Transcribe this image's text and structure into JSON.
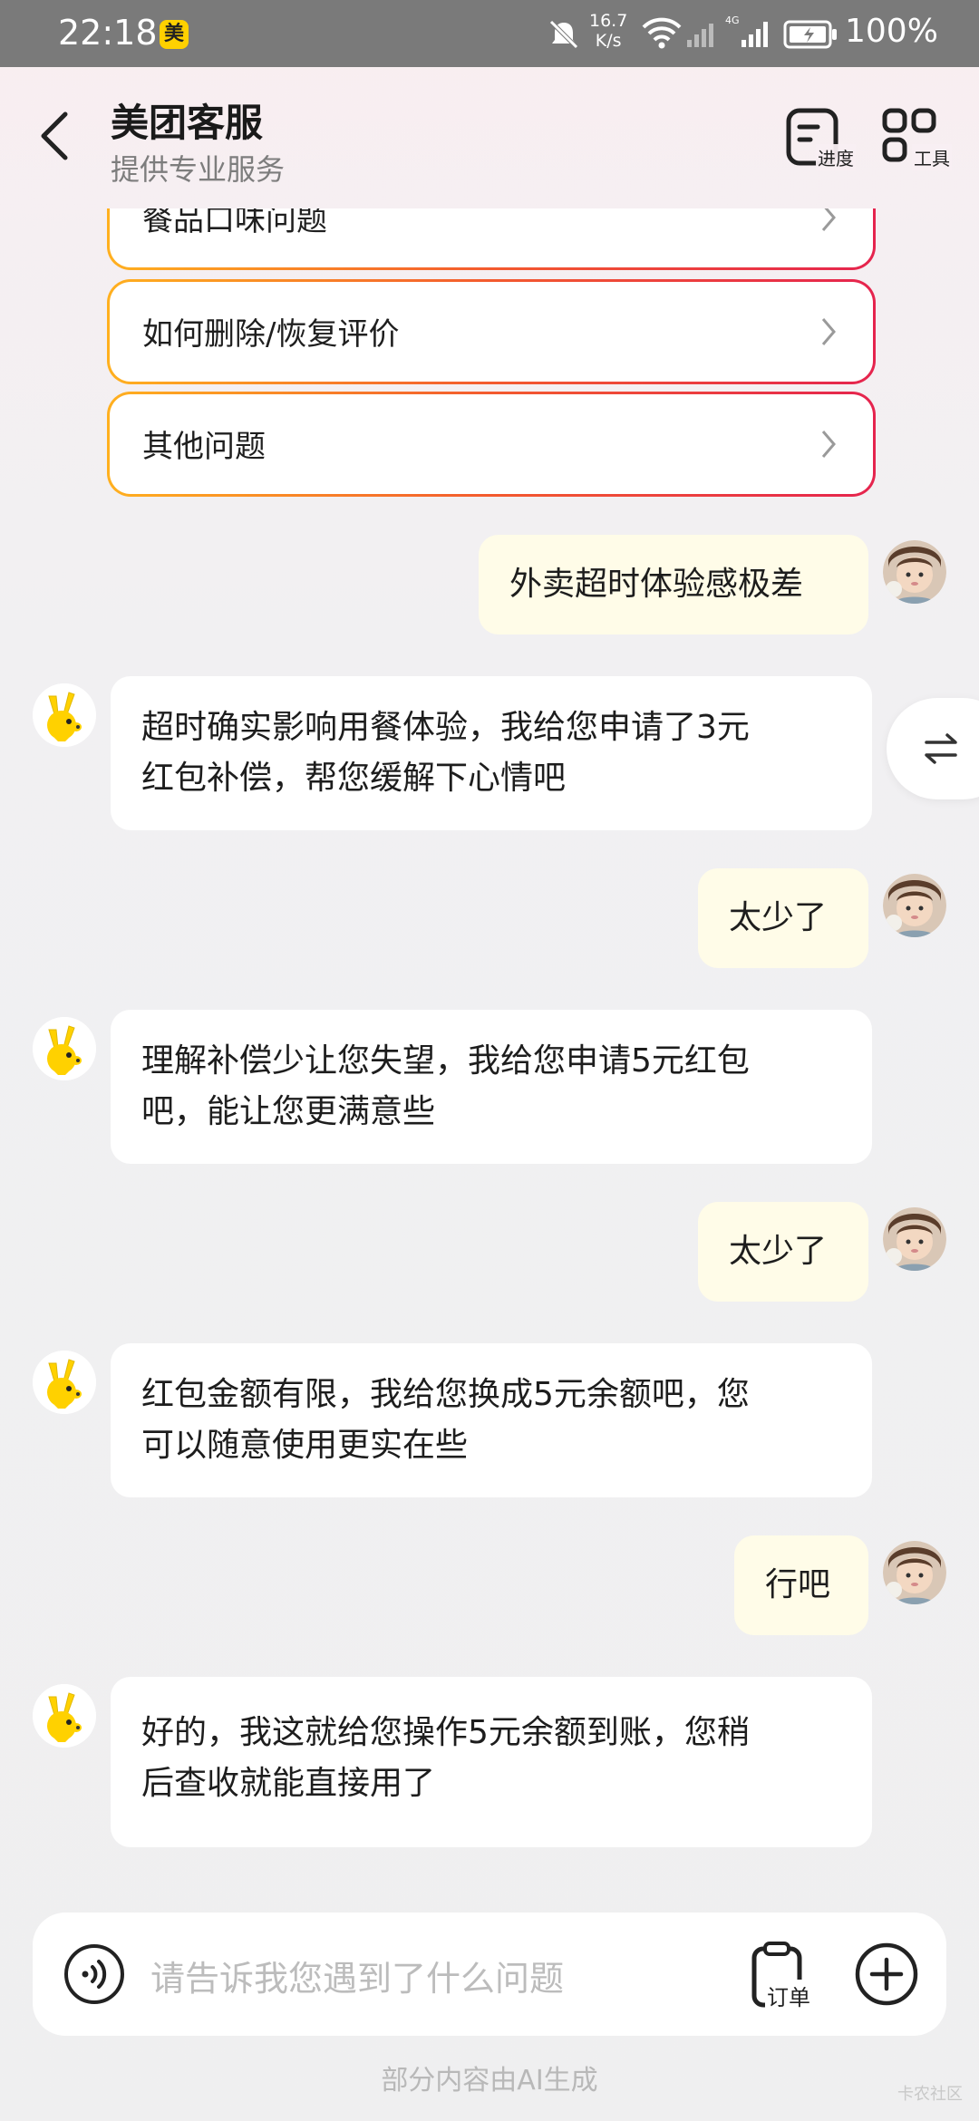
{
  "status_bar": {
    "time": "22:18",
    "app_badge": "美",
    "net_speed_top": "16.7",
    "net_speed_bottom": "K/s",
    "battery": "100%"
  },
  "header": {
    "title": "美团客服",
    "subtitle": "提供专业服务",
    "progress_label": "进度",
    "tools_label": "工具"
  },
  "options": [
    {
      "label": "餐品口味问题"
    },
    {
      "label": "如何删除/恢复评价"
    },
    {
      "label": "其他问题"
    }
  ],
  "messages": [
    {
      "from": "user",
      "text": "外卖超时体验感极差"
    },
    {
      "from": "bot",
      "lines": [
        "超时确实影响用餐体验，我给您申请了3元",
        "红包补偿，帮您缓解下心情吧"
      ]
    },
    {
      "from": "user",
      "text": "太少了"
    },
    {
      "from": "bot",
      "lines": [
        "理解补偿少让您失望，我给您申请5元红包",
        "吧，能让您更满意些"
      ]
    },
    {
      "from": "user",
      "text": "太少了"
    },
    {
      "from": "bot",
      "lines": [
        "红包金额有限，我给您换成5元余额吧，您",
        "可以随意使用更实在些"
      ]
    },
    {
      "from": "user",
      "text": "行吧"
    },
    {
      "from": "bot",
      "lines": [
        "好的，我这就给您操作5元余额到账，您稍",
        "后查收就能直接用了"
      ]
    }
  ],
  "input": {
    "placeholder": "请告诉我您遇到了什么问题",
    "order_label": "订单"
  },
  "footer": {
    "note": "部分内容由AI生成",
    "watermark": "卡农社区"
  },
  "colors": {
    "option_border_start": "#ffb01f",
    "option_border_end": "#e5244e",
    "user_bubble": "#fffce8",
    "bot_bubble": "#ffffff",
    "bot_avatar": "#ffd100"
  }
}
